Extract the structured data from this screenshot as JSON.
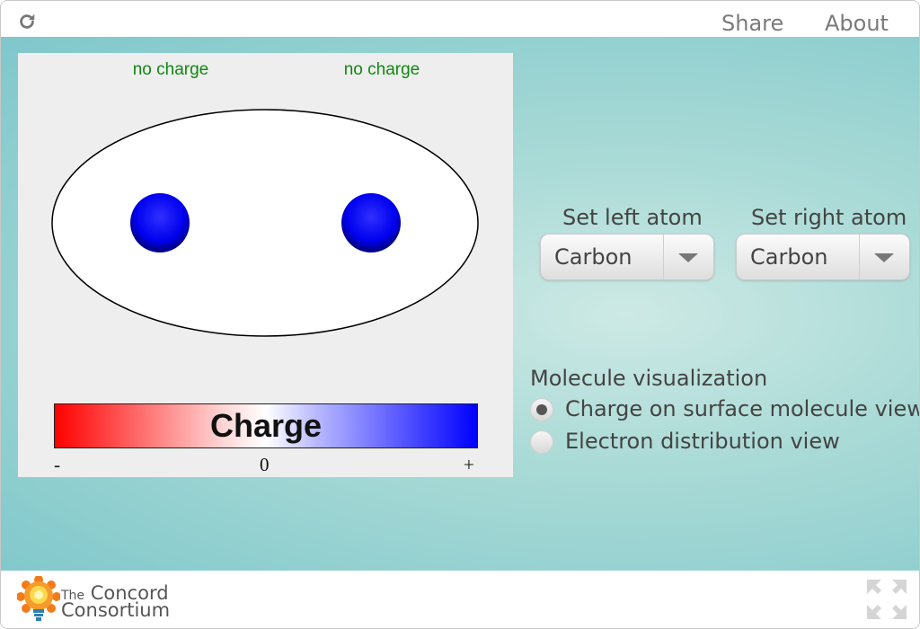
{
  "topbar": {
    "reload_icon": "reload-icon",
    "share_label": "Share",
    "about_label": "About"
  },
  "simulation": {
    "left_charge_label": "no charge",
    "right_charge_label": "no charge",
    "scale_title": "Charge",
    "scale_min": "-",
    "scale_zero": "0",
    "scale_max": "+",
    "colors": {
      "panel": "#eeeeee",
      "atom": "#0000ee",
      "label": "#118811",
      "negative": "#ff0000",
      "positive": "#0000ff"
    }
  },
  "controls": {
    "left_atom_label": "Set left atom",
    "left_atom_value": "Carbon",
    "right_atom_label": "Set right atom",
    "right_atom_value": "Carbon",
    "visualization_title": "Molecule visualization",
    "options": [
      {
        "label": "Charge on surface molecule view",
        "selected": true
      },
      {
        "label": "Electron distribution view",
        "selected": false
      }
    ]
  },
  "footer": {
    "brand_prefix": "The",
    "brand_line1": "Concord",
    "brand_line2": "Consortium",
    "fullscreen_icon": "fullscreen-icon"
  }
}
